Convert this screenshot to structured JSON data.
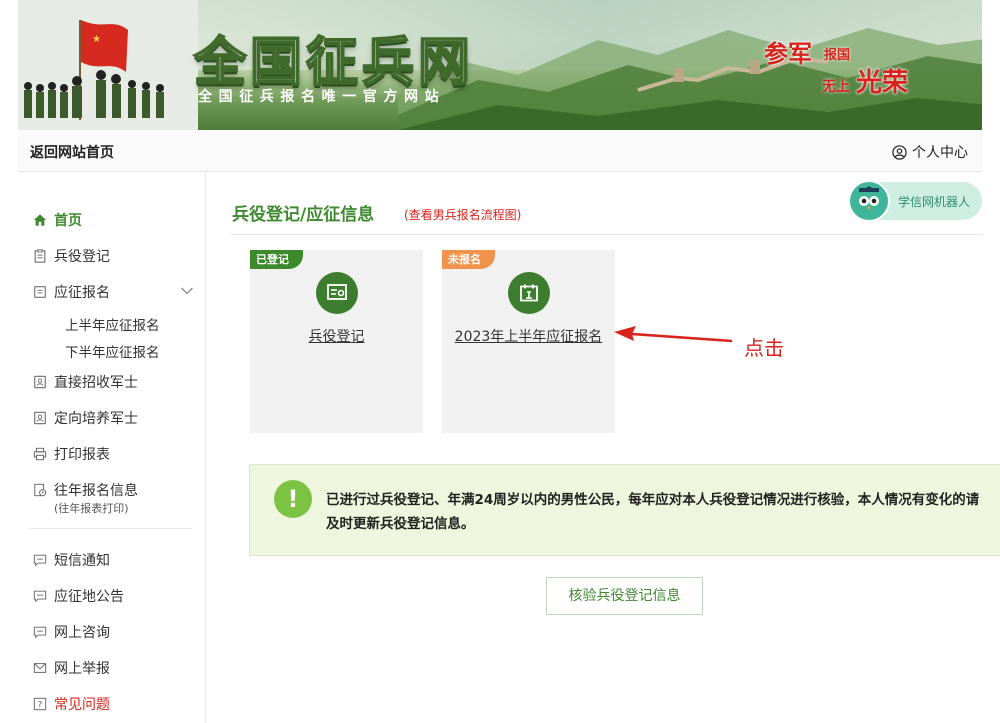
{
  "banner": {
    "title": "全国征兵网",
    "subtitle": "全国征兵报名唯一官方网站",
    "slogan": {
      "part1": "参军",
      "part2": "报国",
      "part3": "无上",
      "part4": "光荣"
    }
  },
  "topbar": {
    "home_link": "返回网站首页",
    "user_center": "个人中心"
  },
  "sidebar": {
    "items": [
      {
        "label": "首页",
        "icon": "home-icon"
      },
      {
        "label": "兵役登记",
        "icon": "clipboard-icon"
      },
      {
        "label": "应征报名",
        "icon": "form-icon"
      },
      {
        "label": "直接招收军士",
        "icon": "id-card-icon"
      },
      {
        "label": "定向培养军士",
        "icon": "id-card-icon"
      },
      {
        "label": "打印报表",
        "icon": "printer-icon"
      },
      {
        "label": "往年报名信息",
        "icon": "history-icon",
        "note": "(往年报表打印)"
      },
      {
        "label": "短信通知",
        "icon": "message-icon"
      },
      {
        "label": "应征地公告",
        "icon": "message-icon"
      },
      {
        "label": "网上咨询",
        "icon": "message-icon"
      },
      {
        "label": "网上举报",
        "icon": "mail-icon"
      },
      {
        "label": "常见问题",
        "icon": "question-icon"
      }
    ],
    "sub_items": [
      "上半年应征报名",
      "下半年应征报名"
    ]
  },
  "main": {
    "title": "兵役登记/应征信息",
    "flow_link": "(查看男兵报名流程图)",
    "robot_label": "学信网机器人",
    "cards": [
      {
        "tag": "已登记",
        "tag_color": "#3d8a2c",
        "label": "兵役登记",
        "icon": "registration-icon"
      },
      {
        "tag": "未报名",
        "tag_color": "#f0934d",
        "label": "2023年上半年应征报名",
        "icon": "calendar-icon"
      }
    ],
    "annotation": "点击",
    "notice": "已进行过兵役登记、年满24周岁以内的男性公民，每年应对本人兵役登记情况进行核验，本人情况有变化的请及时更新兵役登记信息。",
    "verify_button": "核验兵役登记信息"
  },
  "colors": {
    "accent_green": "#3f8a2f",
    "alert_red": "#d9231d",
    "notice_bg": "#eef6dd"
  }
}
